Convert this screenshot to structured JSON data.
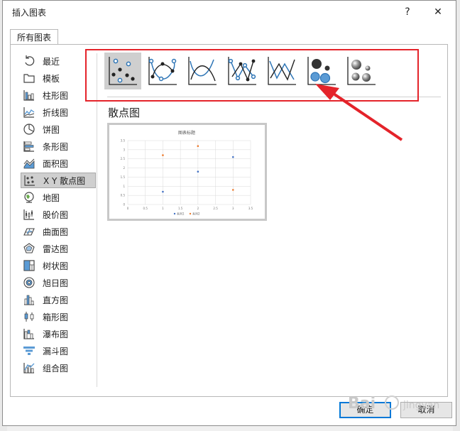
{
  "window": {
    "title": "插入图表",
    "help": "?",
    "close": "✕"
  },
  "tabs": [
    {
      "label": "所有图表"
    }
  ],
  "sidebar": {
    "items": [
      {
        "label": "最近"
      },
      {
        "label": "模板"
      },
      {
        "label": "柱形图"
      },
      {
        "label": "折线图"
      },
      {
        "label": "饼图"
      },
      {
        "label": "条形图"
      },
      {
        "label": "面积图"
      },
      {
        "label": "X Y 散点图"
      },
      {
        "label": "地图"
      },
      {
        "label": "股价图"
      },
      {
        "label": "曲面图"
      },
      {
        "label": "雷达图"
      },
      {
        "label": "树状图"
      },
      {
        "label": "旭日图"
      },
      {
        "label": "直方图"
      },
      {
        "label": "箱形图"
      },
      {
        "label": "瀑布图"
      },
      {
        "label": "漏斗图"
      },
      {
        "label": "组合图"
      }
    ],
    "selected": 7
  },
  "subtypes": {
    "selected": 0,
    "title": "散点图"
  },
  "preview": {
    "chart_title": "图表标题",
    "y_ticks": [
      "3.5",
      "3",
      "2.5",
      "2",
      "1.5",
      "1",
      "0.5",
      "0"
    ],
    "x_ticks": [
      "0",
      "0.5",
      "1",
      "1.5",
      "2",
      "2.5",
      "3",
      "3.5"
    ],
    "legend": [
      "系列1",
      "系列2"
    ],
    "chart_data": {
      "type": "scatter",
      "title": "图表标题",
      "xlim": [
        0,
        3.5
      ],
      "ylim": [
        0,
        3.5
      ],
      "series": [
        {
          "name": "系列1",
          "x": [
            1,
            2,
            3
          ],
          "y": [
            0.7,
            1.8,
            2.6
          ]
        },
        {
          "name": "系列2",
          "x": [
            1,
            2,
            3
          ],
          "y": [
            2.7,
            3.2,
            0.8
          ]
        }
      ]
    }
  },
  "buttons": {
    "ok": "确定",
    "cancel": "取消"
  },
  "colors": {
    "accent": "#0078d7",
    "highlight": "#e4232a",
    "series1": "#4472c4",
    "series2": "#ed7d31"
  }
}
